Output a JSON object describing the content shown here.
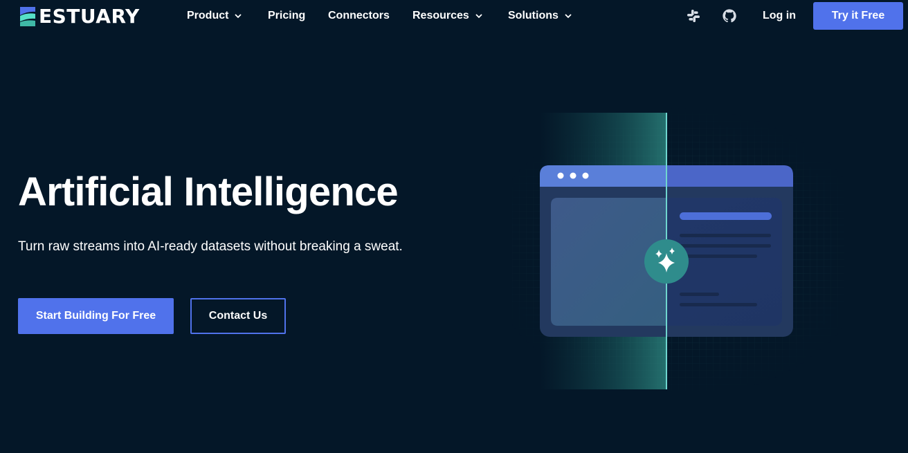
{
  "brand": {
    "name": "ESTUARY",
    "colors": {
      "accent": "#5072eb",
      "background": "#041728",
      "teal": "#56e0c8"
    }
  },
  "nav": {
    "items": [
      {
        "label": "Product",
        "has_dropdown": true
      },
      {
        "label": "Pricing",
        "has_dropdown": false
      },
      {
        "label": "Connectors",
        "has_dropdown": false
      },
      {
        "label": "Resources",
        "has_dropdown": true
      },
      {
        "label": "Solutions",
        "has_dropdown": true
      }
    ],
    "icons": [
      "slack-icon",
      "github-icon"
    ],
    "login_label": "Log in",
    "cta_label": "Try it Free"
  },
  "hero": {
    "title": "Artificial Intelligence",
    "subtitle": "Turn raw streams into AI-ready datasets without breaking a sweat.",
    "primary_button": "Start Building For Free",
    "secondary_button": "Contact Us"
  },
  "illustration": {
    "icon": "sparkles-icon"
  }
}
